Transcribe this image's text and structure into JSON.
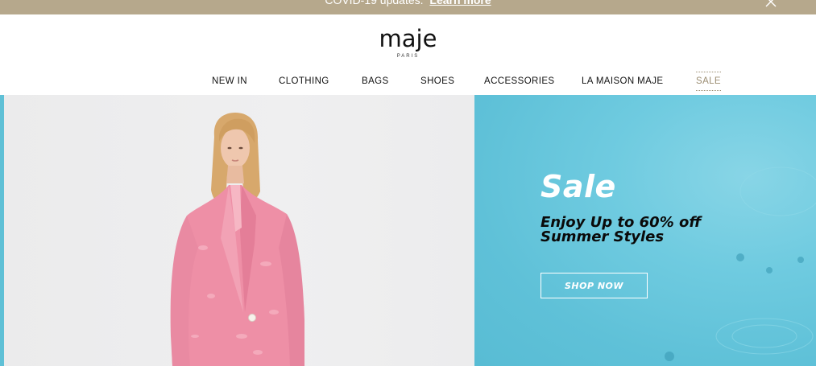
{
  "promo": {
    "text": "COVID-19 updates.",
    "link": "Learn more"
  },
  "brand": {
    "name": "maje",
    "tagline": "PARIS"
  },
  "nav": {
    "new_in": "NEW IN",
    "clothing": "CLOTHING",
    "bags": "BAGS",
    "shoes": "SHOES",
    "accessories": "ACCESSORIES",
    "la_maison": "LA MAISON MAJE",
    "sale": "SALE"
  },
  "hero": {
    "heading": "Sale",
    "line1": "Enjoy Up to 60% off",
    "line2": "Summer Styles",
    "cta": "SHOP NOW"
  },
  "colors": {
    "promo_bar": "#b6a88c",
    "sale_accent": "#9c8e73",
    "panel_blue": "#62c3da",
    "blazer_pink": "#ee8fa6"
  },
  "icons": {
    "close": "close-icon"
  }
}
